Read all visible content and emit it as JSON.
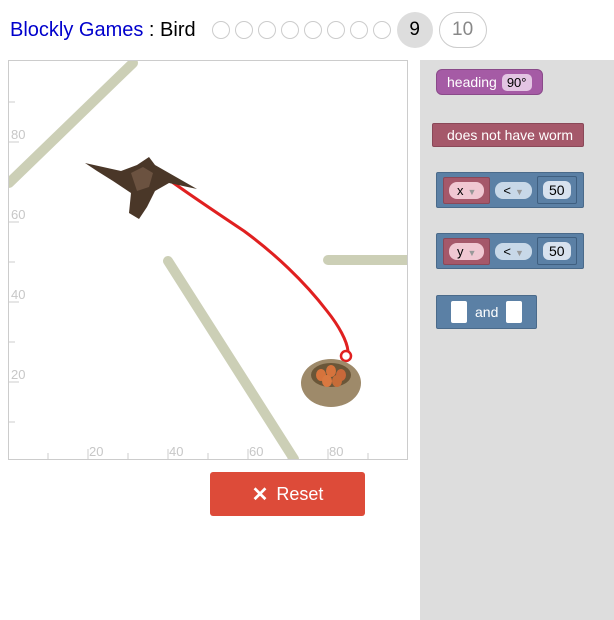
{
  "header": {
    "app_name": "Blockly Games",
    "separator": " : ",
    "game_name": "Bird",
    "levels": [
      "1",
      "2",
      "3",
      "4",
      "5",
      "6",
      "7",
      "8"
    ],
    "current_level": "9",
    "next_level": "10"
  },
  "scene": {
    "axis_ticks_y": [
      "80",
      "60",
      "40",
      "20"
    ],
    "axis_ticks_x": [
      "20",
      "40",
      "60",
      "80"
    ],
    "wall_color": "#cccfb6",
    "path_color": "#e02020"
  },
  "reset_button": {
    "label": "Reset"
  },
  "toolbox": {
    "heading_block": {
      "label": "heading",
      "value": "90°"
    },
    "worm_block": {
      "label": "does not have worm"
    },
    "compare_x": {
      "var": "x",
      "op": "<",
      "value": "50"
    },
    "compare_y": {
      "var": "y",
      "op": "<",
      "value": "50"
    },
    "and_block": {
      "label": "and"
    }
  }
}
